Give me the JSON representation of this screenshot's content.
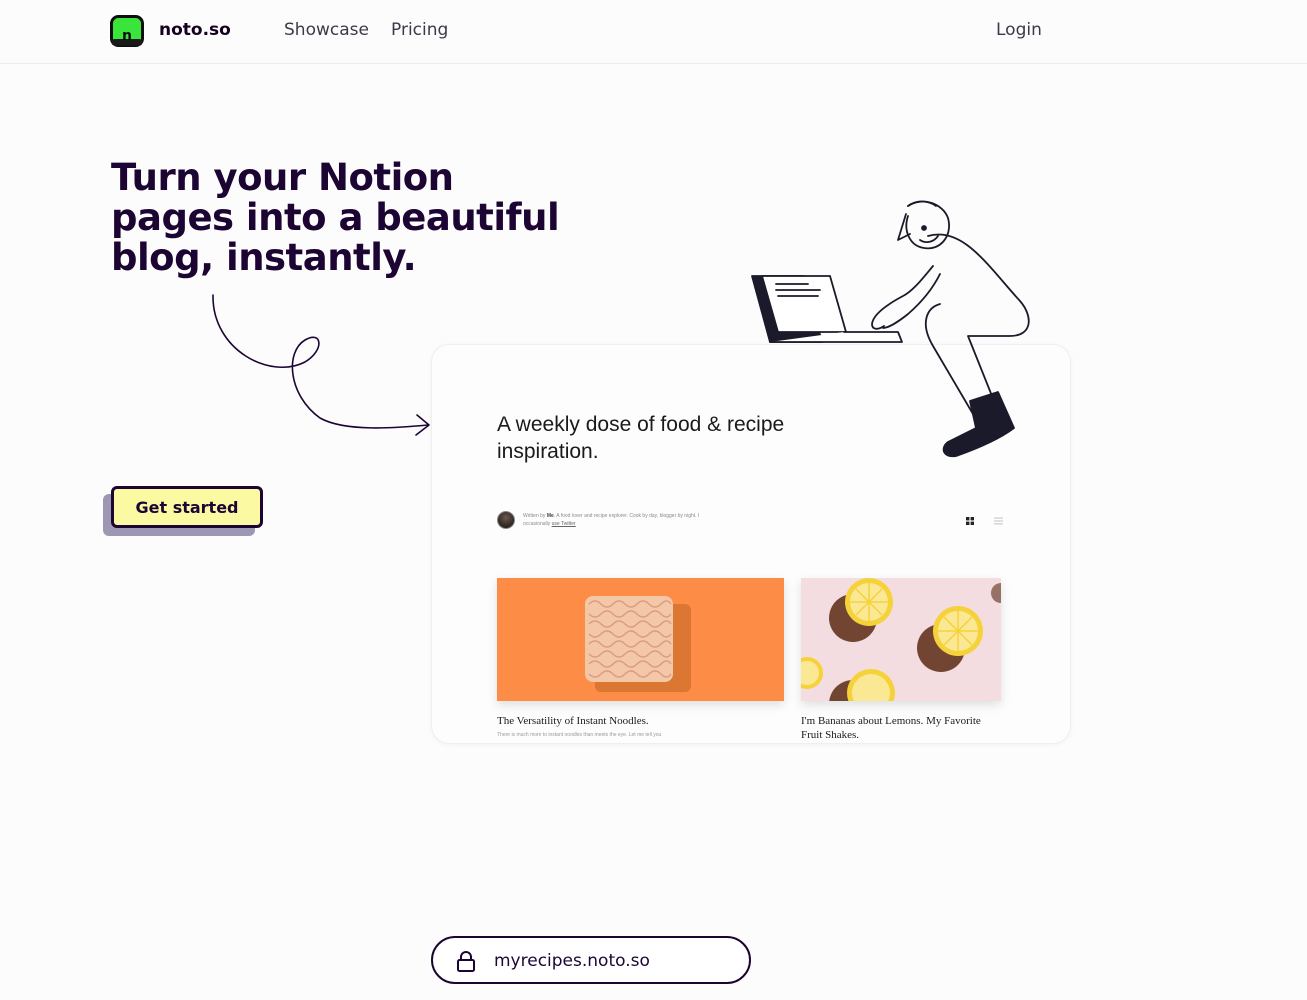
{
  "header": {
    "brand": "noto.so",
    "logo_letter": "n",
    "nav": [
      {
        "label": "Showcase"
      },
      {
        "label": "Pricing"
      }
    ],
    "login_label": "Login"
  },
  "hero": {
    "title": "Turn your Notion pages into a beautiful blog, instantly.",
    "cta_label": "Get started"
  },
  "preview": {
    "blog_title": "A weekly dose of food & recipe inspiration.",
    "author": {
      "prefix": "Written by",
      "name": "Me",
      "bio": ". A food lover and recipe explorer. Cook by day, blogger by night. I occasionally",
      "link": "use Twitter"
    },
    "posts": [
      {
        "title": "The Versatility of Instant Noodles.",
        "excerpt": "There is much more to instant noodles than meets the eye. Let me tell you"
      },
      {
        "title": "I'm Bananas about Lemons. My Favorite Fruit Shakes.",
        "excerpt": ""
      }
    ]
  },
  "url_bar": {
    "text": "myrecipes.noto.so"
  },
  "colors": {
    "brand_green": "#39e53a",
    "ink": "#1c0533",
    "cta_yellow": "#fbfaa3",
    "cta_shadow": "#9d97b3",
    "noodle_orange": "#fd8c46",
    "lemon_bg": "#f3dde0"
  }
}
